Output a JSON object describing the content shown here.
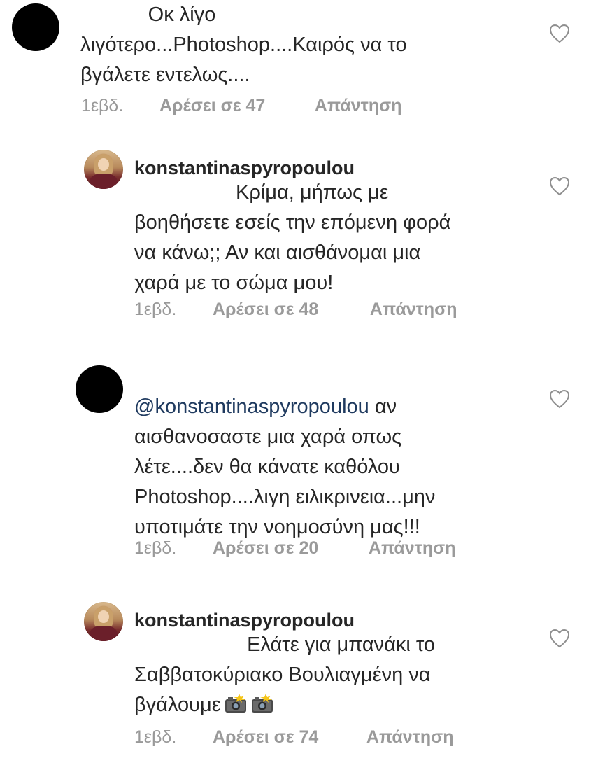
{
  "comments": [
    {
      "username": "",
      "avatar": "redacted",
      "lines": [
        "            Οκ λίγο",
        "λιγότερο...Photoshop....Καιρός να το",
        "βγάλετε εντελως...."
      ],
      "time": "1εβδ.",
      "likes": "Αρέσει σε 47",
      "reply": "Απάντηση"
    },
    {
      "username": "konstantinaspyropoulou",
      "avatar": "photo",
      "lines": [
        "                  Κρίμα, μήπως με",
        "βοηθήσετε εσείς την επόμενη φορά",
        "να κάνω;; Αν και αισθάνομαι μια",
        "χαρά με το σώμα μου!"
      ],
      "time": "1εβδ.",
      "likes": "Αρέσει σε 48",
      "reply": "Απάντηση"
    },
    {
      "username": "",
      "avatar": "redacted",
      "mention": "@konstantinaspyropoulou",
      "first_line_rest": " αν",
      "lines": [
        "αισθανοσαστε μια χαρά οπως",
        "λέτε....δεν θα κάνατε καθόλου",
        "Photoshop....λιγη ειλικρινεια...μην",
        "υποτιμάτε την νοημοσύνη μας!!!"
      ],
      "time": "1εβδ.",
      "likes": "Αρέσει σε 20",
      "reply": "Απάντηση"
    },
    {
      "username": "konstantinaspyropoulou",
      "avatar": "photo",
      "lines": [
        "                    Ελάτε για μπανάκι το",
        "Σαββατοκύριακο Βουλιαγμένη να"
      ],
      "last_line_text": "βγάλουμε",
      "emojis": [
        "camera-flash-icon",
        "camera-flash-icon"
      ],
      "time": "1εβδ.",
      "likes": "Αρέσει σε 74",
      "reply": "Απάντηση"
    }
  ],
  "colors": {
    "text": "#262626",
    "meta": "#999999",
    "mention": "#1f3a5f",
    "redacted": "#000000"
  }
}
